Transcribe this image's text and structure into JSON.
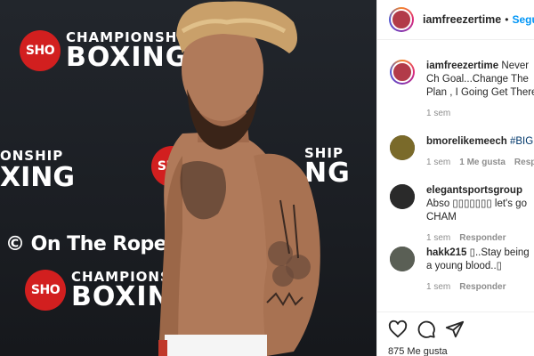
{
  "photo": {
    "logo_top": {
      "badge": "SHO",
      "line1": "CHAMPIONSHIP",
      "line2": "BOXING"
    },
    "logo_mid_left": {
      "line1": "ONSHIP",
      "line2": "XING"
    },
    "logo_mid_right": {
      "badge": "SHO",
      "line1": "SHIP",
      "line2": "NG"
    },
    "logo_bottom": {
      "badge": "SHO",
      "line1": "CHAMPIONSHIP",
      "line2": "BOXING"
    },
    "watermark": "© On The Ropes"
  },
  "header": {
    "username": "iamfreezertime",
    "separator": "•",
    "follow_label": "Seguir"
  },
  "caption": {
    "username": "iamfreezertime",
    "text": "Never Ch Goal...Change The Plan , I Going Get There",
    "time": "1 sem"
  },
  "comments": [
    {
      "username": "bmorelikemeech",
      "text": "#BIGFR",
      "time": "1 sem",
      "likes": "1 Me gusta",
      "reply": "Resp"
    },
    {
      "username": "elegantsportsgroup",
      "text": "Abso ▯▯▯▯▯▯▯ let's go CHAM",
      "time": "1 sem",
      "reply": "Responder"
    },
    {
      "username": "hakk215",
      "text": "▯..Stay being a young blood..▯",
      "time": "1 sem",
      "reply": "Responder"
    }
  ],
  "actions": {
    "like_icon": "heart-icon",
    "comment_icon": "comment-icon",
    "share_icon": "share-icon",
    "likes_text": "875 Me gusta"
  }
}
